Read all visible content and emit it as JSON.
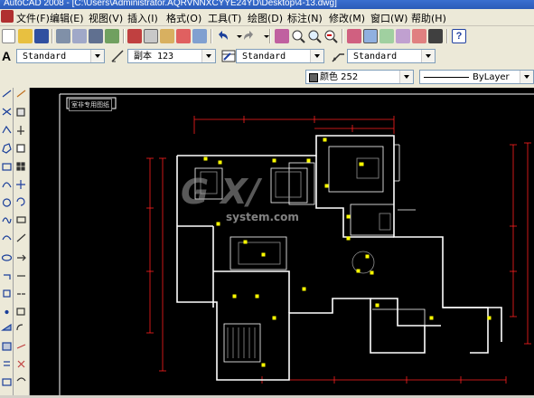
{
  "window": {
    "title": "AutoCAD 2008 - [C:\\Users\\Administrator.AQRVNNXCYYE24YD\\Desktop\\4-13.dwg]"
  },
  "menu": [
    {
      "label": "文件(F)"
    },
    {
      "label": "编辑(E)"
    },
    {
      "label": "视图(V)"
    },
    {
      "label": "插入(I)"
    },
    {
      "label": "格式(O)"
    },
    {
      "label": "工具(T)"
    },
    {
      "label": "绘图(D)"
    },
    {
      "label": "标注(N)"
    },
    {
      "label": "修改(M)"
    },
    {
      "label": "窗口(W)"
    },
    {
      "label": "帮助(H)"
    }
  ],
  "styles": {
    "text_style": "Standard",
    "dim_style": "副本 123",
    "table_style": "Standard",
    "mleader_style": "Standard"
  },
  "properties": {
    "color": "颜色 252",
    "linetype": "ByLayer"
  },
  "drawing": {
    "tag": "室非专用图纸"
  },
  "watermark": {
    "brand": "G X/",
    "site": "system.com"
  },
  "colors": {
    "canvas": "#000000",
    "wall": "#ffffff",
    "dim": "#ff2020",
    "furniture": "#ffff00"
  }
}
